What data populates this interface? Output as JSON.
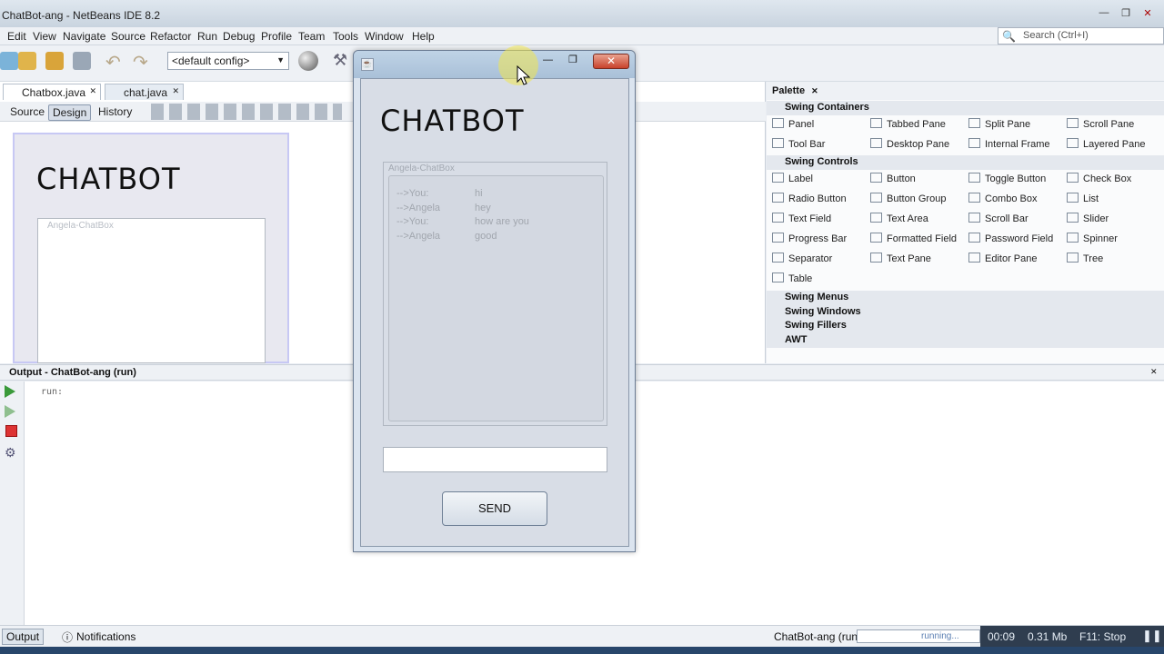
{
  "window": {
    "title": "ChatBot-ang - NetBeans IDE 8.2"
  },
  "menus": [
    "Edit",
    "View",
    "Navigate",
    "Source",
    "Refactor",
    "Run",
    "Debug",
    "Profile",
    "Team",
    "Tools",
    "Window",
    "Help"
  ],
  "search": {
    "placeholder": "Search (Ctrl+I)"
  },
  "toolbar": {
    "config": "<default config>"
  },
  "editor_tabs": [
    "Chatbox.java",
    "chat.java"
  ],
  "editor_views": [
    "Source",
    "Design",
    "History"
  ],
  "design": {
    "title": "CHATBOT",
    "box_label": "Angela-ChatBox"
  },
  "palette": {
    "title": "Palette",
    "sections": {
      "containers": "Swing Containers",
      "controls": "Swing Controls",
      "menus": "Swing Menus",
      "windows": "Swing Windows",
      "fillers": "Swing Fillers",
      "awt": "AWT"
    },
    "containers": [
      "Panel",
      "Tabbed Pane",
      "Split Pane",
      "Scroll Pane",
      "Tool Bar",
      "Desktop Pane",
      "Internal Frame",
      "Layered Pane"
    ],
    "controls": [
      "Label",
      "Button",
      "Toggle Button",
      "Check Box",
      "Radio Button",
      "Button Group",
      "Combo Box",
      "List",
      "Text Field",
      "Text Area",
      "Scroll Bar",
      "Slider",
      "Progress Bar",
      "Formatted Field",
      "Password Field",
      "Spinner",
      "Separator",
      "Text Pane",
      "Editor Pane",
      "Tree",
      "Table"
    ]
  },
  "output": {
    "title": "Output - ChatBot-ang (run)",
    "text": "run:"
  },
  "status": {
    "tab_output": "Output",
    "tab_notifications": "Notifications",
    "process": "ChatBot-ang (run)",
    "progress_text": "running...",
    "time": "00:09",
    "memory": "0.31 Mb",
    "stop": "F11: Stop"
  },
  "chatbot": {
    "title": "CHATBOT",
    "group_label": "Angela-ChatBox",
    "messages": [
      {
        "who": "-->You:",
        "text": "hi"
      },
      {
        "who": "-->Angela",
        "text": "hey"
      },
      {
        "who": "-->You:",
        "text": "how are you"
      },
      {
        "who": "-->Angela",
        "text": "good"
      }
    ],
    "input_value": "",
    "send_label": "SEND"
  }
}
